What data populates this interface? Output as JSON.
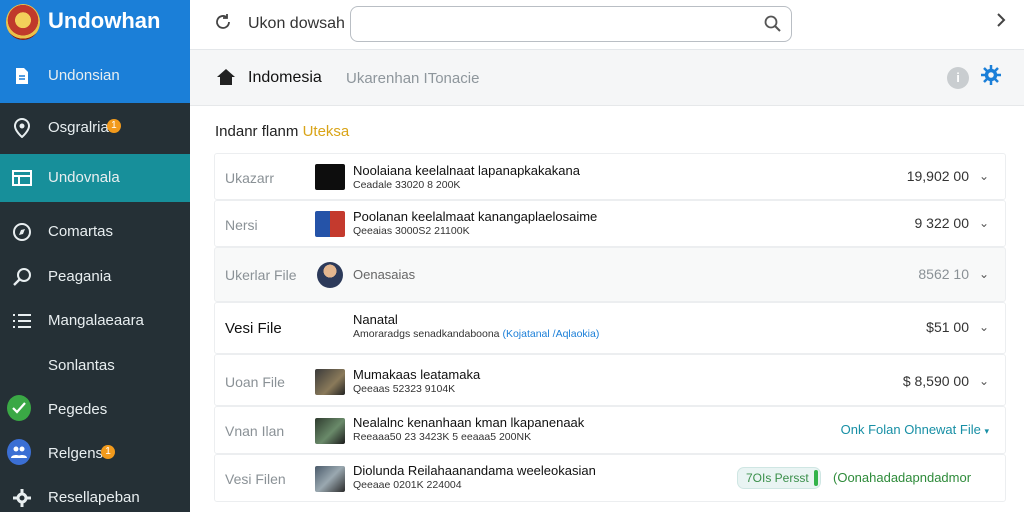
{
  "app": {
    "brand": "Undowhan",
    "brand_item": "Undonsian"
  },
  "sidebar": {
    "items": [
      {
        "label": "Osgralria",
        "icon": "pin-icon",
        "badge": "1"
      },
      {
        "label": "Undovnala",
        "icon": "folder-icon",
        "active": true
      },
      {
        "label": "Comartas",
        "icon": "compass-icon"
      },
      {
        "label": "Peagania",
        "icon": "search-icon"
      },
      {
        "label": "Mangalaeaara",
        "icon": "list-icon"
      },
      {
        "label": "Sonlantas",
        "icon": ""
      },
      {
        "label": "Pegedes",
        "icon": "check-circle-icon"
      },
      {
        "label": "Relgens",
        "icon": "users-icon",
        "badge": "1"
      },
      {
        "label": "Resellapeban",
        "icon": "settings-icon"
      }
    ]
  },
  "topbar": {
    "title": "Ukon dowsah",
    "search_value": ""
  },
  "header": {
    "title": "Indomesia",
    "subtitle": "Ukarenhan ITonacie"
  },
  "section": {
    "title": "Indanr flanm",
    "accent": "Uteksa"
  },
  "colors": {
    "brand": "#1b7fd8",
    "active": "#178f9a",
    "sidebar": "#253036",
    "badge": "#f29a1c"
  },
  "files": [
    {
      "label": "Ukazarr",
      "name": "Noolaiana keelalnaat lapanapkakakana",
      "meta": "Ceadale 33020 8 200K",
      "value": "19,902 00"
    },
    {
      "label": "Nersi",
      "name": "Poolanan keelalmaat kanangaplaelosaime",
      "meta": "Qeeaias 3000S2 21100K",
      "value": "9 322 00"
    },
    {
      "label": "Ukerlar File",
      "name": "Oenasaias",
      "meta": "",
      "value": "8562 10"
    },
    {
      "label": "Vesi File",
      "name": "Nanatal",
      "meta": "Amoraradgs senadkandaboona",
      "meta_link": "(Kojatanal /Aqlaokia)",
      "value": "$51 00"
    },
    {
      "label": "Uoan File",
      "name": "Mumakaas leatamaka",
      "meta": "Qeeaas 52323 9104K",
      "value": "$ 8,590 00"
    },
    {
      "label": "Vnan Ilan",
      "name": "Nealalnc kenanhaan kman lkapanenaak",
      "meta": "Reeaaa50 23 3423K 5 eeaaa5 200NK",
      "action": "Onk Folan Ohnewat File"
    },
    {
      "label": "Vesi Filen",
      "name": "Diolunda Reilahaanandama weeleokasian",
      "meta": "Qeeaae 0201K 224004",
      "pill": "7OIs Persst",
      "status": "(Oonahadadapndadmor"
    }
  ]
}
